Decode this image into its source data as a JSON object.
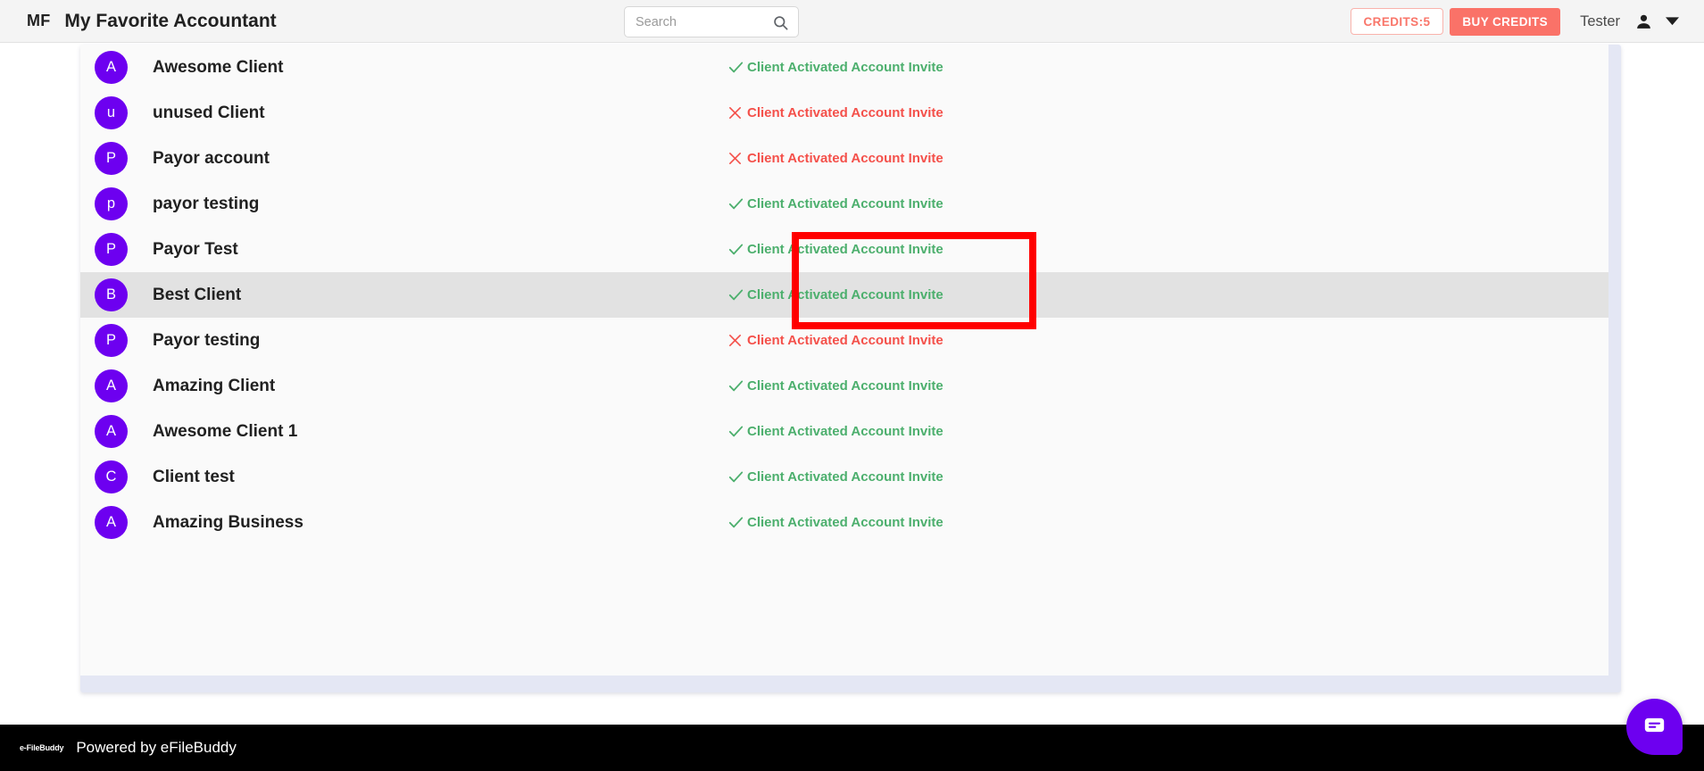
{
  "header": {
    "brand_mark": "MF",
    "brand_title": "My Favorite Accountant",
    "search_placeholder": "Search",
    "search_value": "",
    "credits_label": "CREDITS:5",
    "buy_credits_label": "BUY CREDITS",
    "user_name": "Tester",
    "accent_color": "#fa7268"
  },
  "clients": [
    {
      "initial": "A",
      "name": "Awesome Client",
      "status": "Client Activated Account Invite",
      "state": "ok",
      "highlight": false
    },
    {
      "initial": "u",
      "name": "unused Client",
      "status": "Client Activated Account Invite",
      "state": "fail",
      "highlight": false
    },
    {
      "initial": "P",
      "name": "Payor account",
      "status": "Client Activated Account Invite",
      "state": "fail",
      "highlight": false
    },
    {
      "initial": "p",
      "name": "payor testing",
      "status": "Client Activated Account Invite",
      "state": "ok",
      "highlight": false
    },
    {
      "initial": "P",
      "name": "Payor Test",
      "status": "Client Activated Account Invite",
      "state": "ok",
      "highlight": false
    },
    {
      "initial": "B",
      "name": "Best Client",
      "status": "Client Activated Account Invite",
      "state": "ok",
      "highlight": true
    },
    {
      "initial": "P",
      "name": "Payor testing",
      "status": "Client Activated Account Invite",
      "state": "fail",
      "highlight": false
    },
    {
      "initial": "A",
      "name": "Amazing Client",
      "status": "Client Activated Account Invite",
      "state": "ok",
      "highlight": false
    },
    {
      "initial": "A",
      "name": "Awesome Client 1",
      "status": "Client Activated Account Invite",
      "state": "ok",
      "highlight": false
    },
    {
      "initial": "C",
      "name": "Client test",
      "status": "Client Activated Account Invite",
      "state": "ok",
      "highlight": false
    },
    {
      "initial": "A",
      "name": "Amazing Business",
      "status": "Client Activated Account Invite",
      "state": "ok",
      "highlight": false
    }
  ],
  "colors": {
    "avatar": "#6d00f0",
    "status_ok": "#4caf6d",
    "status_fail": "#f4504a",
    "annotation": "#ff0000",
    "panel": "#e4e7f4",
    "row_highlight": "#e2e2e2"
  },
  "footer": {
    "logo_text": "e-FileBuddy",
    "powered_by": "Powered by eFileBuddy"
  },
  "chat": {
    "icon": "chat-icon"
  }
}
